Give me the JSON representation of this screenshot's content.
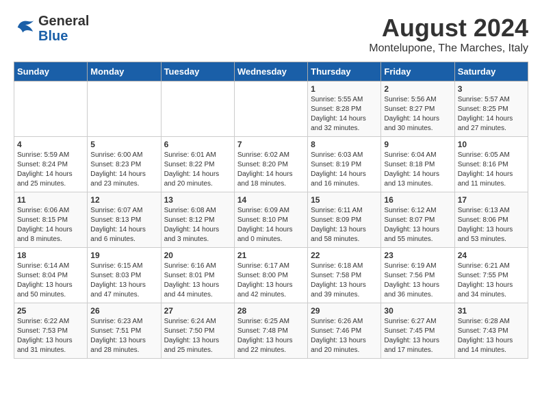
{
  "logo": {
    "general": "General",
    "blue": "Blue"
  },
  "title": "August 2024",
  "subtitle": "Montelupone, The Marches, Italy",
  "days_of_week": [
    "Sunday",
    "Monday",
    "Tuesday",
    "Wednesday",
    "Thursday",
    "Friday",
    "Saturday"
  ],
  "weeks": [
    [
      {
        "day": "",
        "sunrise": "",
        "sunset": "",
        "daylight": ""
      },
      {
        "day": "",
        "sunrise": "",
        "sunset": "",
        "daylight": ""
      },
      {
        "day": "",
        "sunrise": "",
        "sunset": "",
        "daylight": ""
      },
      {
        "day": "",
        "sunrise": "",
        "sunset": "",
        "daylight": ""
      },
      {
        "day": "1",
        "sunrise": "Sunrise: 5:55 AM",
        "sunset": "Sunset: 8:28 PM",
        "daylight": "Daylight: 14 hours and 32 minutes."
      },
      {
        "day": "2",
        "sunrise": "Sunrise: 5:56 AM",
        "sunset": "Sunset: 8:27 PM",
        "daylight": "Daylight: 14 hours and 30 minutes."
      },
      {
        "day": "3",
        "sunrise": "Sunrise: 5:57 AM",
        "sunset": "Sunset: 8:25 PM",
        "daylight": "Daylight: 14 hours and 27 minutes."
      }
    ],
    [
      {
        "day": "4",
        "sunrise": "Sunrise: 5:59 AM",
        "sunset": "Sunset: 8:24 PM",
        "daylight": "Daylight: 14 hours and 25 minutes."
      },
      {
        "day": "5",
        "sunrise": "Sunrise: 6:00 AM",
        "sunset": "Sunset: 8:23 PM",
        "daylight": "Daylight: 14 hours and 23 minutes."
      },
      {
        "day": "6",
        "sunrise": "Sunrise: 6:01 AM",
        "sunset": "Sunset: 8:22 PM",
        "daylight": "Daylight: 14 hours and 20 minutes."
      },
      {
        "day": "7",
        "sunrise": "Sunrise: 6:02 AM",
        "sunset": "Sunset: 8:20 PM",
        "daylight": "Daylight: 14 hours and 18 minutes."
      },
      {
        "day": "8",
        "sunrise": "Sunrise: 6:03 AM",
        "sunset": "Sunset: 8:19 PM",
        "daylight": "Daylight: 14 hours and 16 minutes."
      },
      {
        "day": "9",
        "sunrise": "Sunrise: 6:04 AM",
        "sunset": "Sunset: 8:18 PM",
        "daylight": "Daylight: 14 hours and 13 minutes."
      },
      {
        "day": "10",
        "sunrise": "Sunrise: 6:05 AM",
        "sunset": "Sunset: 8:16 PM",
        "daylight": "Daylight: 14 hours and 11 minutes."
      }
    ],
    [
      {
        "day": "11",
        "sunrise": "Sunrise: 6:06 AM",
        "sunset": "Sunset: 8:15 PM",
        "daylight": "Daylight: 14 hours and 8 minutes."
      },
      {
        "day": "12",
        "sunrise": "Sunrise: 6:07 AM",
        "sunset": "Sunset: 8:13 PM",
        "daylight": "Daylight: 14 hours and 6 minutes."
      },
      {
        "day": "13",
        "sunrise": "Sunrise: 6:08 AM",
        "sunset": "Sunset: 8:12 PM",
        "daylight": "Daylight: 14 hours and 3 minutes."
      },
      {
        "day": "14",
        "sunrise": "Sunrise: 6:09 AM",
        "sunset": "Sunset: 8:10 PM",
        "daylight": "Daylight: 14 hours and 0 minutes."
      },
      {
        "day": "15",
        "sunrise": "Sunrise: 6:11 AM",
        "sunset": "Sunset: 8:09 PM",
        "daylight": "Daylight: 13 hours and 58 minutes."
      },
      {
        "day": "16",
        "sunrise": "Sunrise: 6:12 AM",
        "sunset": "Sunset: 8:07 PM",
        "daylight": "Daylight: 13 hours and 55 minutes."
      },
      {
        "day": "17",
        "sunrise": "Sunrise: 6:13 AM",
        "sunset": "Sunset: 8:06 PM",
        "daylight": "Daylight: 13 hours and 53 minutes."
      }
    ],
    [
      {
        "day": "18",
        "sunrise": "Sunrise: 6:14 AM",
        "sunset": "Sunset: 8:04 PM",
        "daylight": "Daylight: 13 hours and 50 minutes."
      },
      {
        "day": "19",
        "sunrise": "Sunrise: 6:15 AM",
        "sunset": "Sunset: 8:03 PM",
        "daylight": "Daylight: 13 hours and 47 minutes."
      },
      {
        "day": "20",
        "sunrise": "Sunrise: 6:16 AM",
        "sunset": "Sunset: 8:01 PM",
        "daylight": "Daylight: 13 hours and 44 minutes."
      },
      {
        "day": "21",
        "sunrise": "Sunrise: 6:17 AM",
        "sunset": "Sunset: 8:00 PM",
        "daylight": "Daylight: 13 hours and 42 minutes."
      },
      {
        "day": "22",
        "sunrise": "Sunrise: 6:18 AM",
        "sunset": "Sunset: 7:58 PM",
        "daylight": "Daylight: 13 hours and 39 minutes."
      },
      {
        "day": "23",
        "sunrise": "Sunrise: 6:19 AM",
        "sunset": "Sunset: 7:56 PM",
        "daylight": "Daylight: 13 hours and 36 minutes."
      },
      {
        "day": "24",
        "sunrise": "Sunrise: 6:21 AM",
        "sunset": "Sunset: 7:55 PM",
        "daylight": "Daylight: 13 hours and 34 minutes."
      }
    ],
    [
      {
        "day": "25",
        "sunrise": "Sunrise: 6:22 AM",
        "sunset": "Sunset: 7:53 PM",
        "daylight": "Daylight: 13 hours and 31 minutes."
      },
      {
        "day": "26",
        "sunrise": "Sunrise: 6:23 AM",
        "sunset": "Sunset: 7:51 PM",
        "daylight": "Daylight: 13 hours and 28 minutes."
      },
      {
        "day": "27",
        "sunrise": "Sunrise: 6:24 AM",
        "sunset": "Sunset: 7:50 PM",
        "daylight": "Daylight: 13 hours and 25 minutes."
      },
      {
        "day": "28",
        "sunrise": "Sunrise: 6:25 AM",
        "sunset": "Sunset: 7:48 PM",
        "daylight": "Daylight: 13 hours and 22 minutes."
      },
      {
        "day": "29",
        "sunrise": "Sunrise: 6:26 AM",
        "sunset": "Sunset: 7:46 PM",
        "daylight": "Daylight: 13 hours and 20 minutes."
      },
      {
        "day": "30",
        "sunrise": "Sunrise: 6:27 AM",
        "sunset": "Sunset: 7:45 PM",
        "daylight": "Daylight: 13 hours and 17 minutes."
      },
      {
        "day": "31",
        "sunrise": "Sunrise: 6:28 AM",
        "sunset": "Sunset: 7:43 PM",
        "daylight": "Daylight: 13 hours and 14 minutes."
      }
    ]
  ]
}
